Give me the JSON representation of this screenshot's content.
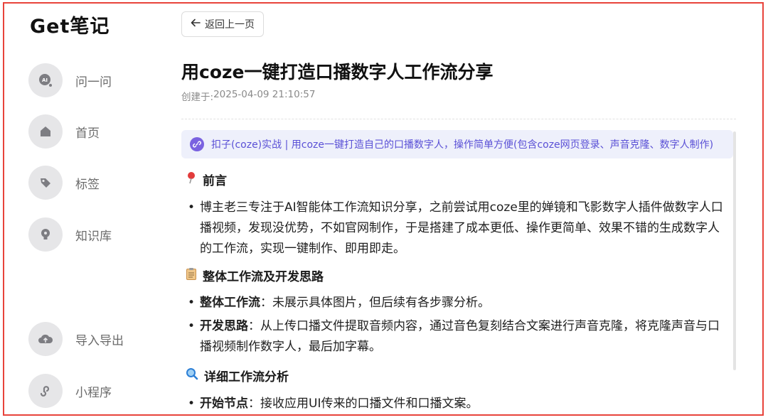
{
  "app": {
    "logo": "Get笔记"
  },
  "sidebar": {
    "items": [
      {
        "label": "问一问",
        "icon": "ai-chat-icon"
      },
      {
        "label": "首页",
        "icon": "home-icon"
      },
      {
        "label": "标签",
        "icon": "tag-icon"
      },
      {
        "label": "知识库",
        "icon": "lightbulb-icon"
      },
      {
        "label": "导入导出",
        "icon": "cloud-upload-icon"
      },
      {
        "label": "小程序",
        "icon": "mini-program-icon"
      }
    ]
  },
  "header": {
    "back_label": "返回上一页"
  },
  "note": {
    "title": "用coze一键打造口播数字人工作流分享",
    "created_prefix": "创建于: ",
    "created_at": "2025-04-09 21:10:57",
    "link_text": "扣子(coze)实战 | 用coze一键打造自己的口播数字人，操作简单方便(包含coze网页登录、声音克隆、数字人制作)"
  },
  "sections": [
    {
      "title": "前言",
      "icon": "pushpin-icon",
      "bullets": [
        {
          "bold": "",
          "text": "博主老三专注于AI智能体工作流知识分享，之前尝试用coze里的婵镜和飞影数字人插件做数字人口播视频，发现没优势，不如官网制作，于是搭建了成本更低、操作更简单、效果不错的生成数字人的工作流，实现一键制作、即用即走。"
        }
      ]
    },
    {
      "title": "整体工作流及开发思路",
      "icon": "clipboard-icon",
      "bullets": [
        {
          "bold": "整体工作流",
          "text": "：未展示具体图片，但后续有各步骤分析。"
        },
        {
          "bold": "开发思路",
          "text": "：从上传口播文件提取音频内容，通过音色复刻结合文案进行声音克隆，将克隆声音与口播视频制作数字人，最后加字幕。"
        }
      ]
    },
    {
      "title": "详细工作流分析",
      "icon": "magnifier-icon",
      "bullets": [
        {
          "bold": "开始节点",
          "text": "：接收应用UI传来的口播文件和口播文案。"
        }
      ]
    }
  ],
  "colors": {
    "accent": "#5a50d6",
    "frame": "#e8433b",
    "link_bg": "#eef0fb"
  }
}
